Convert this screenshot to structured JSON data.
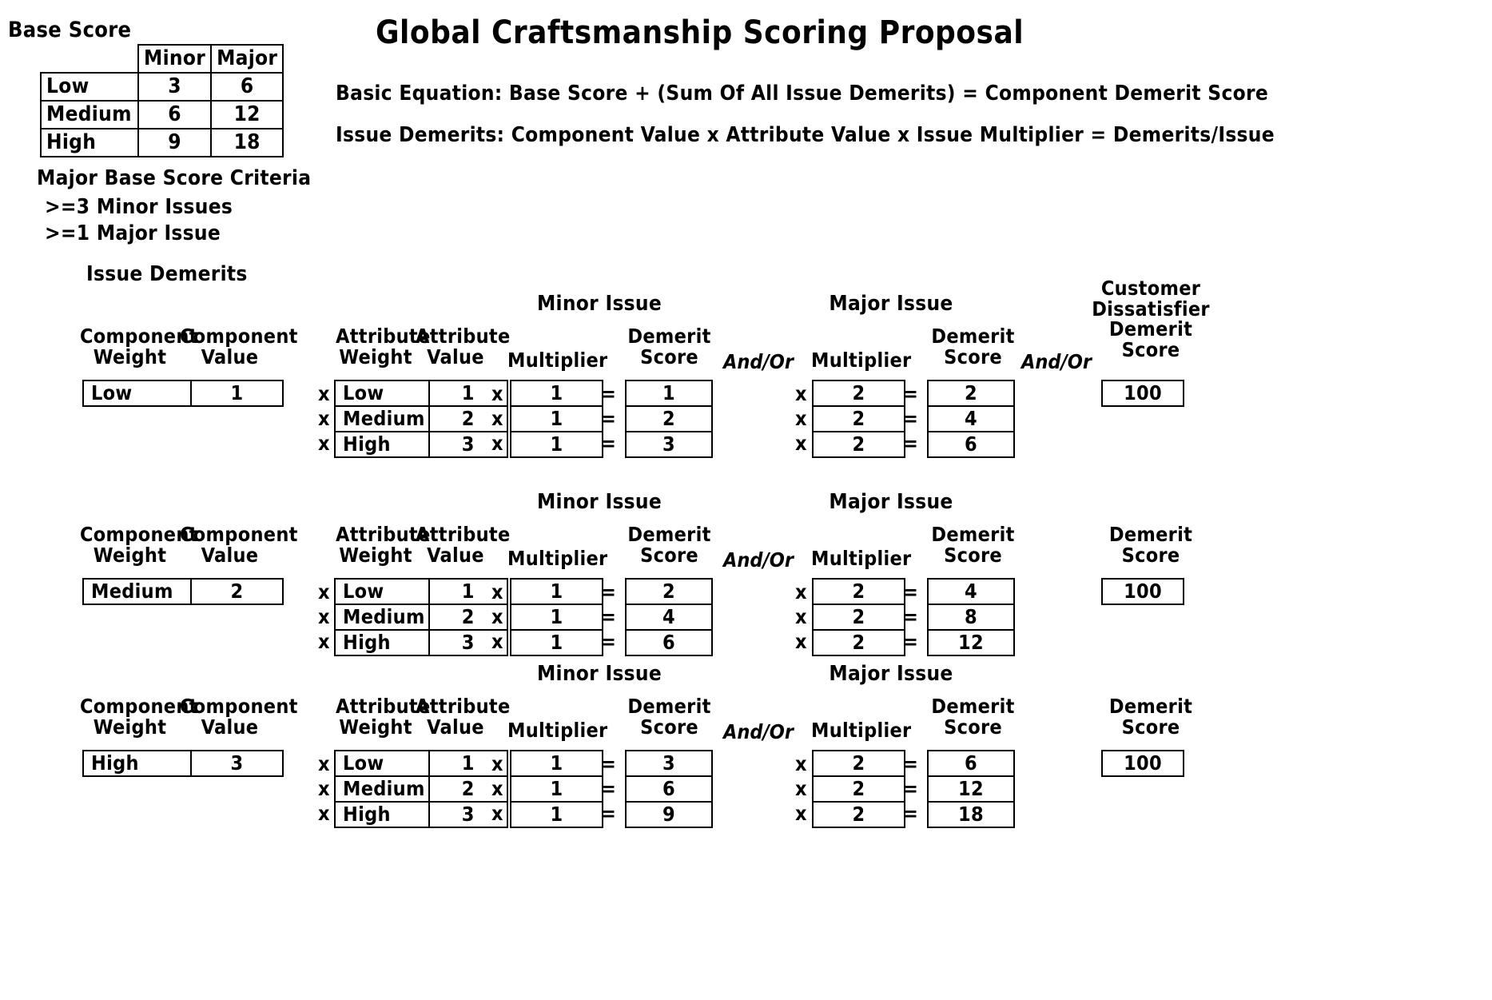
{
  "header": {
    "title": "Global Craftsmanship Scoring Proposal",
    "equation_1": "Basic Equation: Base Score + (Sum Of All Issue Demerits) = Component Demerit Score",
    "equation_2": "Issue Demerits: Component Value x Attribute Value x Issue Multiplier = Demerits/Issue"
  },
  "base_score": {
    "label": "Base Score",
    "columns": [
      "Minor",
      "Major"
    ],
    "rows": [
      {
        "name": "Low",
        "minor": "3",
        "major": "6"
      },
      {
        "name": "Medium",
        "minor": "6",
        "major": "12"
      },
      {
        "name": "High",
        "minor": "9",
        "major": "18"
      }
    ]
  },
  "criteria": {
    "title": "Major Base Score Criteria",
    "item_1": ">=3 Minor Issues",
    "item_2": ">=1 Major Issue"
  },
  "labels": {
    "issue_demerits": "Issue Demerits",
    "component_weight": "Component",
    "component_weight_2": "Weight",
    "component_value": "Component",
    "component_value_2": "Value",
    "attribute_weight": "Attribute",
    "attribute_weight_2": "Weight",
    "attribute_value": "Attribute",
    "attribute_value_2": "Value",
    "multiplier": "Multiplier",
    "demerit": "Demerit",
    "score": "Score",
    "minor_issue": "Minor Issue",
    "major_issue": "Major Issue",
    "and_or": "And/Or",
    "customer": "Customer",
    "dissatisfier": "Dissatisfier",
    "times": "x",
    "equals": "="
  },
  "blocks": [
    {
      "component_weight": "Low",
      "component_value": "1",
      "customer_dissatisfier_score": "100",
      "customer_header": [
        "Customer",
        "Dissatisfier",
        "Demerit",
        "Score"
      ],
      "rows": [
        {
          "attribute_weight": "Low",
          "attribute_value": "1",
          "minor_multiplier": "1",
          "minor_demerit": "1",
          "major_multiplier": "2",
          "major_demerit": "2"
        },
        {
          "attribute_weight": "Medium",
          "attribute_value": "2",
          "minor_multiplier": "1",
          "minor_demerit": "2",
          "major_multiplier": "2",
          "major_demerit": "4"
        },
        {
          "attribute_weight": "High",
          "attribute_value": "3",
          "minor_multiplier": "1",
          "minor_demerit": "3",
          "major_multiplier": "2",
          "major_demerit": "6"
        }
      ]
    },
    {
      "component_weight": "Medium",
      "component_value": "2",
      "customer_dissatisfier_score": "100",
      "customer_header": [
        "Demerit",
        "Score"
      ],
      "rows": [
        {
          "attribute_weight": "Low",
          "attribute_value": "1",
          "minor_multiplier": "1",
          "minor_demerit": "2",
          "major_multiplier": "2",
          "major_demerit": "4"
        },
        {
          "attribute_weight": "Medium",
          "attribute_value": "2",
          "minor_multiplier": "1",
          "minor_demerit": "4",
          "major_multiplier": "2",
          "major_demerit": "8"
        },
        {
          "attribute_weight": "High",
          "attribute_value": "3",
          "minor_multiplier": "1",
          "minor_demerit": "6",
          "major_multiplier": "2",
          "major_demerit": "12"
        }
      ]
    },
    {
      "component_weight": "High",
      "component_value": "3",
      "customer_dissatisfier_score": "100",
      "customer_header": [
        "Demerit",
        "Score"
      ],
      "rows": [
        {
          "attribute_weight": "Low",
          "attribute_value": "1",
          "minor_multiplier": "1",
          "minor_demerit": "3",
          "major_multiplier": "2",
          "major_demerit": "6"
        },
        {
          "attribute_weight": "Medium",
          "attribute_value": "2",
          "minor_multiplier": "1",
          "minor_demerit": "6",
          "major_multiplier": "2",
          "major_demerit": "12"
        },
        {
          "attribute_weight": "High",
          "attribute_value": "3",
          "minor_multiplier": "1",
          "minor_demerit": "9",
          "major_multiplier": "2",
          "major_demerit": "18"
        }
      ]
    }
  ]
}
